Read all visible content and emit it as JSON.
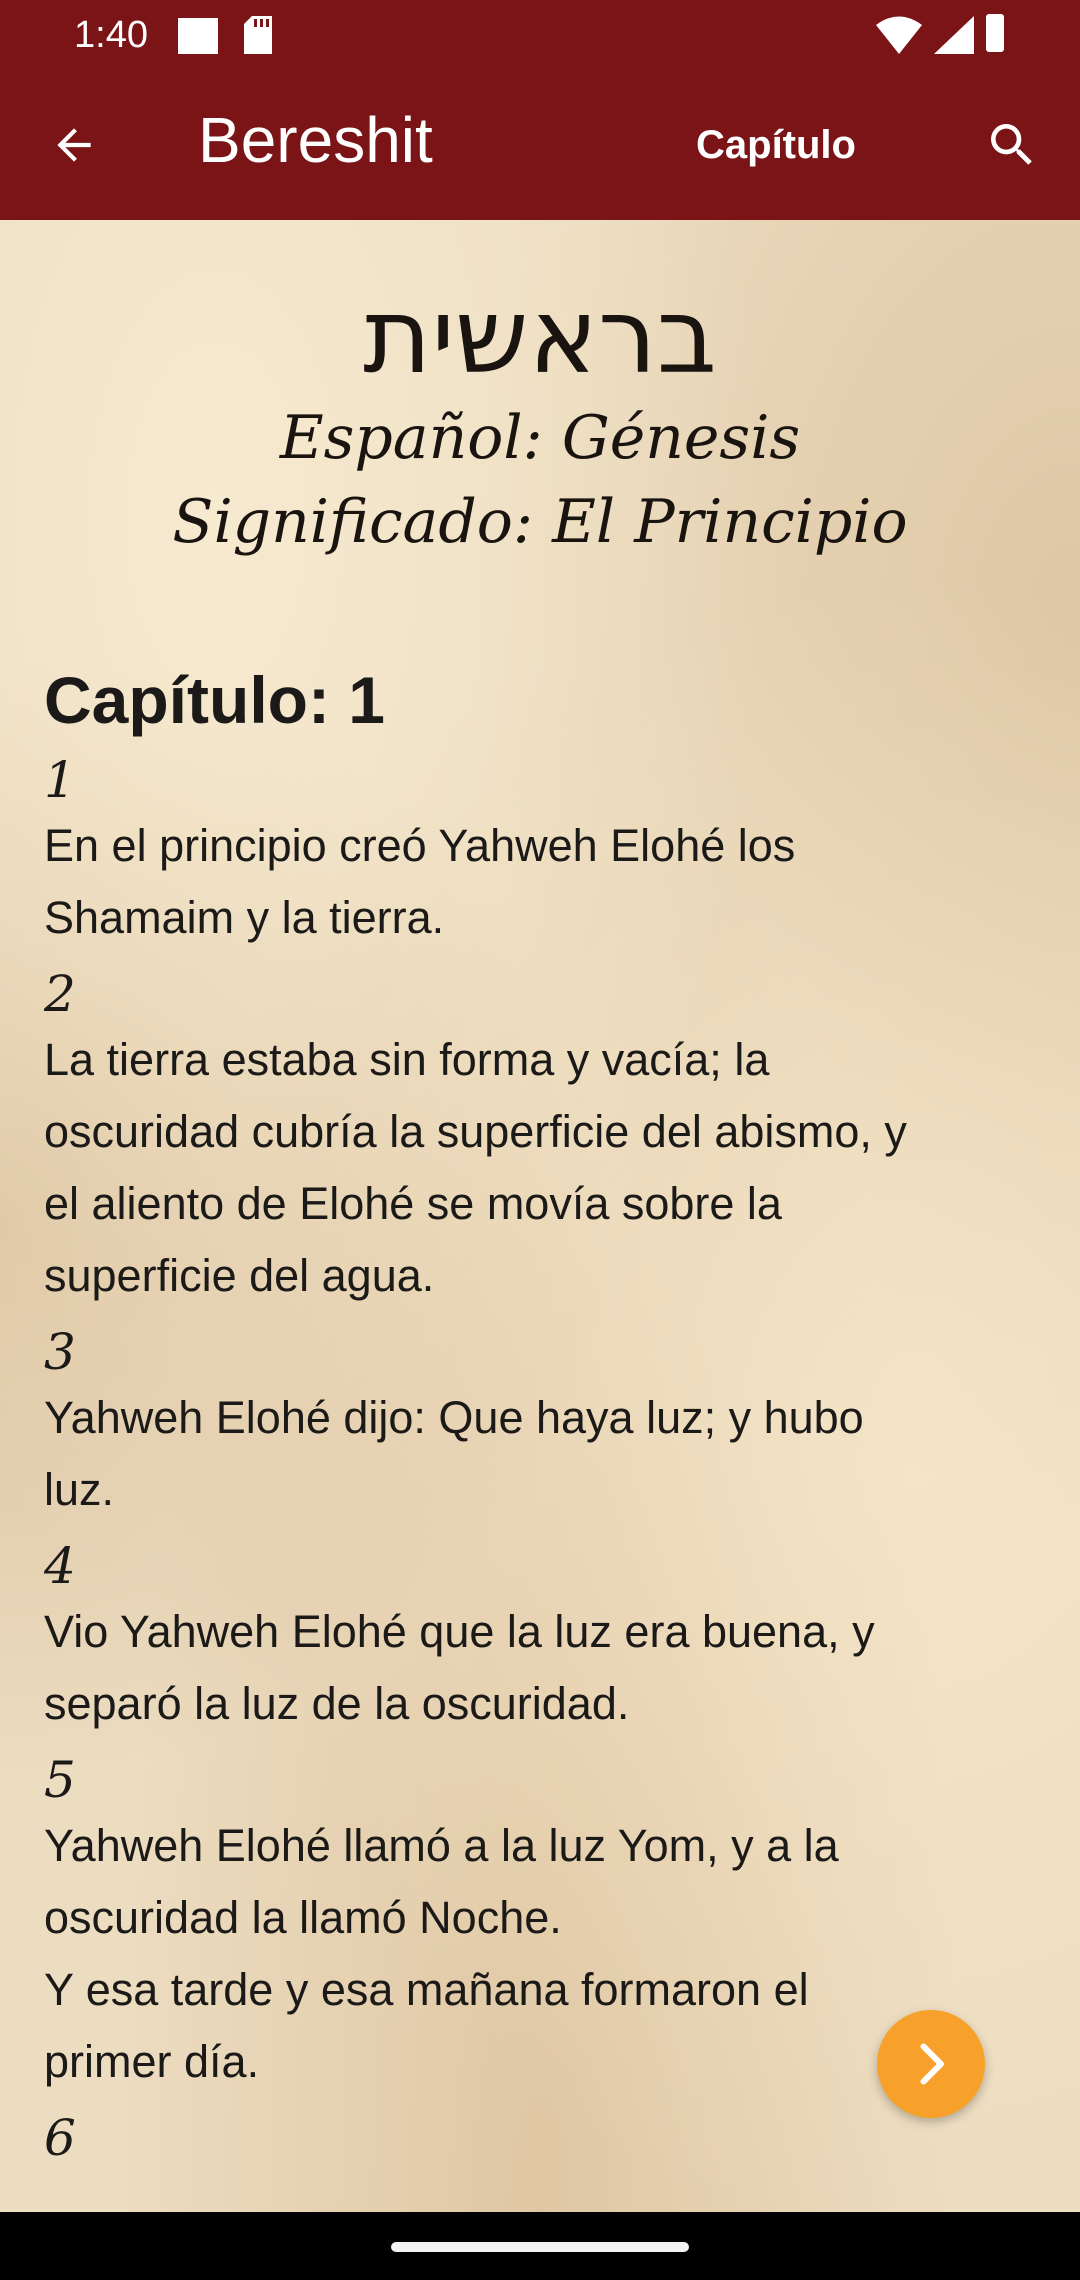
{
  "status_bar": {
    "time": "1:40",
    "icons": [
      "notification-square-icon",
      "sd-card-icon",
      "wifi-icon",
      "cell-signal-icon",
      "battery-icon"
    ]
  },
  "toolbar": {
    "title": "Bereshit",
    "chapter_button": "Capítulo",
    "back_icon": "arrow-back-icon",
    "search_icon": "search-icon",
    "background_color": "#7b1416"
  },
  "book_header": {
    "hebrew_title": "בראשית",
    "english_name": "Español: Génesis",
    "meaning": "Significado: El Principio"
  },
  "chapter": {
    "heading": "Capítulo: 1",
    "verses": [
      {
        "number": "1",
        "lines": [
          "En el principio creó Yahweh Elohé los",
          "Shamaim y la tierra."
        ]
      },
      {
        "number": "2",
        "lines": [
          "La tierra estaba sin forma y vacía; la",
          "oscuridad cubría la superficie del abismo, y",
          "el aliento de Elohé se movía sobre la",
          "superficie del agua."
        ]
      },
      {
        "number": "3",
        "lines": [
          "Yahweh Elohé dijo: Que haya luz; y hubo",
          "luz."
        ]
      },
      {
        "number": "4",
        "lines": [
          "Vio Yahweh Elohé que la luz era buena, y",
          "separó la luz de la oscuridad."
        ]
      },
      {
        "number": "5",
        "lines": [
          "Yahweh Elohé llamó a la luz Yom, y a la",
          "oscuridad la llamó Noche.",
          "Y esa tarde y esa mañana formaron el",
          "primer día."
        ]
      },
      {
        "number": "6",
        "lines": []
      }
    ]
  },
  "fab": {
    "icon": "chevron-right-icon",
    "color": "#f8a12a"
  }
}
